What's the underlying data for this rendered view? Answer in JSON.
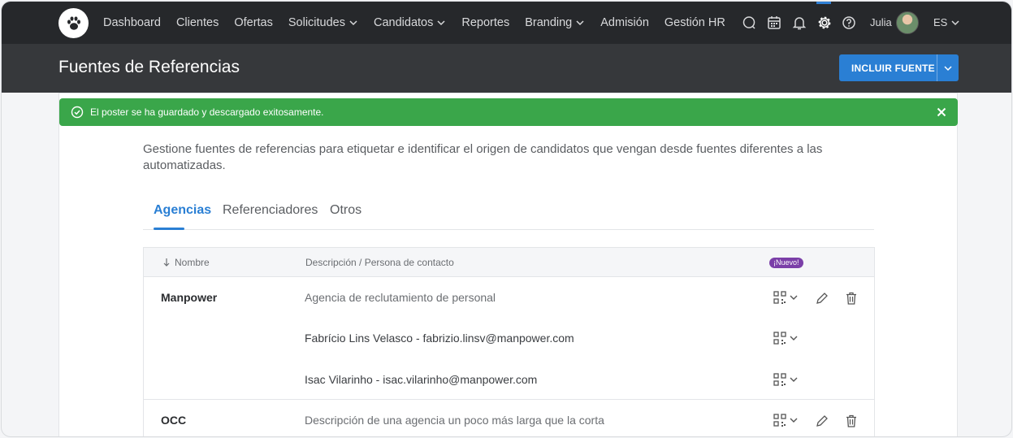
{
  "nav": {
    "items": [
      {
        "label": "Dashboard",
        "dropdown": false
      },
      {
        "label": "Clientes",
        "dropdown": false
      },
      {
        "label": "Ofertas",
        "dropdown": false
      },
      {
        "label": "Solicitudes",
        "dropdown": true
      },
      {
        "label": "Candidatos",
        "dropdown": true
      },
      {
        "label": "Reportes",
        "dropdown": false
      },
      {
        "label": "Branding",
        "dropdown": true
      },
      {
        "label": "Admisión",
        "dropdown": false
      },
      {
        "label": "Gestión HR",
        "dropdown": false
      }
    ],
    "user_name": "Julia",
    "language": "ES",
    "icons": [
      "chat-icon",
      "calendar-icon",
      "bell-icon",
      "gear-icon",
      "help-icon"
    ]
  },
  "header": {
    "title": "Fuentes de Referencias",
    "include_button": "INCLUIR FUENTE"
  },
  "alert": {
    "message": "El poster se ha guardado y descargado exitosamente.",
    "color": "#3aa64a"
  },
  "description": "Gestione fuentes de referencias para etiquetar e identificar el origen de candidatos que vengan desde fuentes diferentes a las automatizadas.",
  "tabs": [
    {
      "label": "Agencias",
      "active": true
    },
    {
      "label": "Referenciadores",
      "active": false
    },
    {
      "label": "Otros",
      "active": false
    }
  ],
  "table": {
    "columns": {
      "name": "Nombre",
      "description": "Descripción / Persona de contacto",
      "new_badge": "¡Nuevo!"
    },
    "rows": [
      {
        "name": "Manpower",
        "description": "Agencia de reclutamiento de personal"
      },
      {
        "contact": "Fabrício Lins Velasco - fabrizio.linsv@manpower.com"
      },
      {
        "contact": "Isac Vilarinho - isac.vilarinho@manpower.com"
      },
      {
        "name": "OCC",
        "description": "Descripción de una agencia un poco más larga que la corta"
      }
    ]
  },
  "colors": {
    "accent": "#2a7fd4",
    "nav_bg": "#26282b",
    "header_bg": "#36383b",
    "badge": "#7b3fa8"
  }
}
